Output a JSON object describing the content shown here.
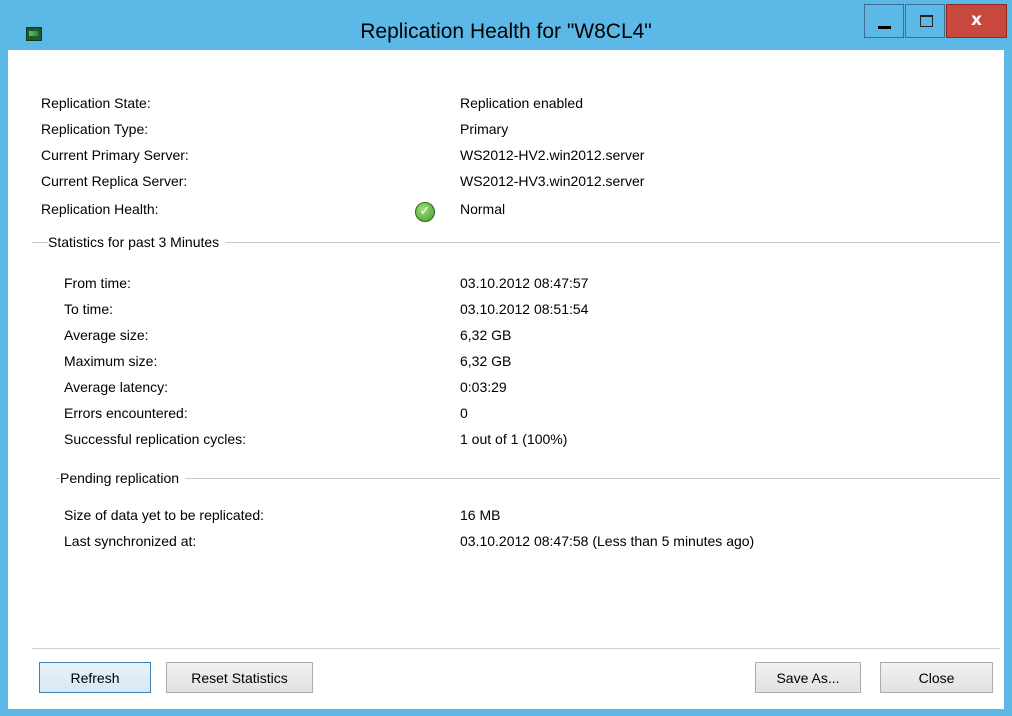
{
  "window": {
    "title": "Replication Health for \"W8CL4\"",
    "controls": {
      "minimize": "",
      "maximize": "",
      "close": "x"
    }
  },
  "summary": [
    {
      "label": "Replication State:",
      "value": "Replication enabled"
    },
    {
      "label": "Replication Type:",
      "value": "Primary"
    },
    {
      "label": "Current Primary Server:",
      "value": "WS2012-HV2.win2012.server"
    },
    {
      "label": "Current Replica Server:",
      "value": "WS2012-HV3.win2012.server"
    },
    {
      "label": "Replication Health:",
      "value": "Normal",
      "icon": "green-check-icon"
    }
  ],
  "statistics": {
    "header": "Statistics for past 3 Minutes",
    "rows": [
      {
        "label": "From time:",
        "value": "03.10.2012 08:47:57"
      },
      {
        "label": "To time:",
        "value": "03.10.2012 08:51:54"
      },
      {
        "label": "Average size:",
        "value": "6,32 GB"
      },
      {
        "label": "Maximum size:",
        "value": "6,32 GB"
      },
      {
        "label": "Average latency:",
        "value": "0:03:29"
      },
      {
        "label": "Errors encountered:",
        "value": "0"
      },
      {
        "label": "Successful replication cycles:",
        "value": "1 out of 1 (100%)"
      }
    ]
  },
  "pending": {
    "header": "Pending replication",
    "rows": [
      {
        "label": "Size of data yet to be replicated:",
        "value": "16 MB"
      },
      {
        "label": "Last synchronized at:",
        "value": "03.10.2012 08:47:58 (Less than 5 minutes ago)"
      }
    ]
  },
  "buttons": {
    "refresh": "Refresh",
    "reset_statistics": "Reset Statistics",
    "save_as": "Save As...",
    "close": "Close"
  },
  "colors": {
    "titlebar": "#5cb8e6",
    "close_button": "#c9483e",
    "status_ok": "#3f9a2c"
  }
}
